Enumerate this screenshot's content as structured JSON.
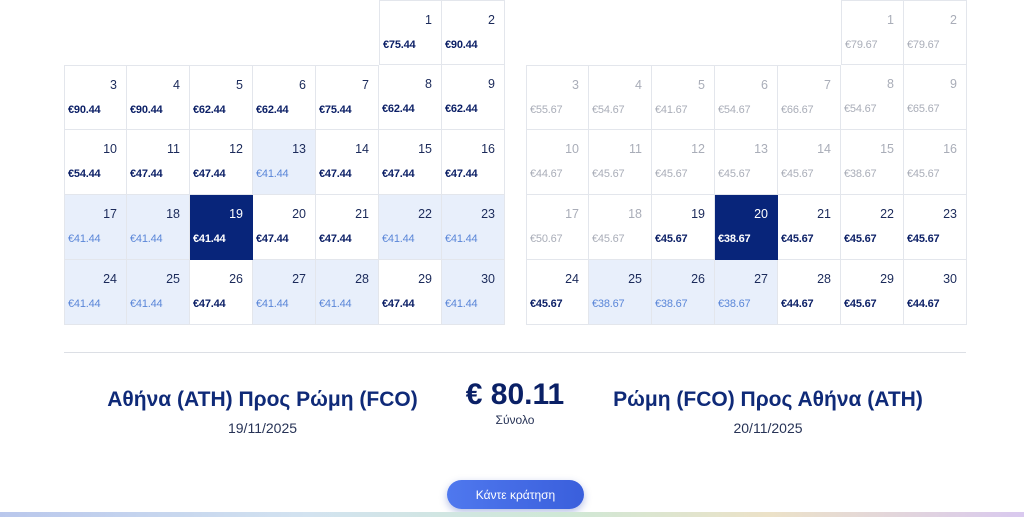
{
  "outbound_calendar": {
    "cells": [
      {
        "day": "1",
        "price": "€75.44",
        "state": "normal"
      },
      {
        "day": "2",
        "price": "€90.44",
        "state": "normal"
      },
      {
        "day": "3",
        "price": "€90.44",
        "state": "normal"
      },
      {
        "day": "4",
        "price": "€90.44",
        "state": "normal"
      },
      {
        "day": "5",
        "price": "€62.44",
        "state": "normal"
      },
      {
        "day": "6",
        "price": "€62.44",
        "state": "normal"
      },
      {
        "day": "7",
        "price": "€75.44",
        "state": "normal"
      },
      {
        "day": "8",
        "price": "€62.44",
        "state": "normal"
      },
      {
        "day": "9",
        "price": "€62.44",
        "state": "normal"
      },
      {
        "day": "10",
        "price": "€54.44",
        "state": "normal"
      },
      {
        "day": "11",
        "price": "€47.44",
        "state": "normal"
      },
      {
        "day": "12",
        "price": "€47.44",
        "state": "normal"
      },
      {
        "day": "13",
        "price": "€41.44",
        "state": "low"
      },
      {
        "day": "14",
        "price": "€47.44",
        "state": "normal"
      },
      {
        "day": "15",
        "price": "€47.44",
        "state": "normal"
      },
      {
        "day": "16",
        "price": "€47.44",
        "state": "normal"
      },
      {
        "day": "17",
        "price": "€41.44",
        "state": "low"
      },
      {
        "day": "18",
        "price": "€41.44",
        "state": "low"
      },
      {
        "day": "19",
        "price": "€41.44",
        "state": "selected"
      },
      {
        "day": "20",
        "price": "€47.44",
        "state": "normal"
      },
      {
        "day": "21",
        "price": "€47.44",
        "state": "normal"
      },
      {
        "day": "22",
        "price": "€41.44",
        "state": "low"
      },
      {
        "day": "23",
        "price": "€41.44",
        "state": "low"
      },
      {
        "day": "24",
        "price": "€41.44",
        "state": "low"
      },
      {
        "day": "25",
        "price": "€41.44",
        "state": "low"
      },
      {
        "day": "26",
        "price": "€47.44",
        "state": "normal"
      },
      {
        "day": "27",
        "price": "€41.44",
        "state": "low"
      },
      {
        "day": "28",
        "price": "€41.44",
        "state": "low"
      },
      {
        "day": "29",
        "price": "€47.44",
        "state": "normal"
      },
      {
        "day": "30",
        "price": "€41.44",
        "state": "low"
      }
    ]
  },
  "return_calendar": {
    "cells": [
      {
        "day": "1",
        "price": "€79.67",
        "state": "disabled"
      },
      {
        "day": "2",
        "price": "€79.67",
        "state": "disabled"
      },
      {
        "day": "3",
        "price": "€55.67",
        "state": "disabled"
      },
      {
        "day": "4",
        "price": "€54.67",
        "state": "disabled"
      },
      {
        "day": "5",
        "price": "€41.67",
        "state": "disabled"
      },
      {
        "day": "6",
        "price": "€54.67",
        "state": "disabled"
      },
      {
        "day": "7",
        "price": "€66.67",
        "state": "disabled"
      },
      {
        "day": "8",
        "price": "€54.67",
        "state": "disabled"
      },
      {
        "day": "9",
        "price": "€65.67",
        "state": "disabled"
      },
      {
        "day": "10",
        "price": "€44.67",
        "state": "disabled"
      },
      {
        "day": "11",
        "price": "€45.67",
        "state": "disabled"
      },
      {
        "day": "12",
        "price": "€45.67",
        "state": "disabled"
      },
      {
        "day": "13",
        "price": "€45.67",
        "state": "disabled"
      },
      {
        "day": "14",
        "price": "€45.67",
        "state": "disabled"
      },
      {
        "day": "15",
        "price": "€38.67",
        "state": "disabled"
      },
      {
        "day": "16",
        "price": "€45.67",
        "state": "disabled"
      },
      {
        "day": "17",
        "price": "€50.67",
        "state": "disabled"
      },
      {
        "day": "18",
        "price": "€45.67",
        "state": "disabled"
      },
      {
        "day": "19",
        "price": "€45.67",
        "state": "normal"
      },
      {
        "day": "20",
        "price": "€38.67",
        "state": "selected"
      },
      {
        "day": "21",
        "price": "€45.67",
        "state": "normal"
      },
      {
        "day": "22",
        "price": "€45.67",
        "state": "normal"
      },
      {
        "day": "23",
        "price": "€45.67",
        "state": "normal"
      },
      {
        "day": "24",
        "price": "€45.67",
        "state": "normal"
      },
      {
        "day": "25",
        "price": "€38.67",
        "state": "low"
      },
      {
        "day": "26",
        "price": "€38.67",
        "state": "low"
      },
      {
        "day": "27",
        "price": "€38.67",
        "state": "low"
      },
      {
        "day": "28",
        "price": "€44.67",
        "state": "normal"
      },
      {
        "day": "29",
        "price": "€45.67",
        "state": "normal"
      },
      {
        "day": "30",
        "price": "€44.67",
        "state": "normal"
      }
    ]
  },
  "summary": {
    "outbound_route": "Αθήνα (ATH) Προς Ρώμη (FCO)",
    "outbound_date": "19/11/2025",
    "total_amount": "€ 80.11",
    "total_label": "Σύνολο",
    "return_route": "Ρώμη (FCO) Προς Αθήνα (ATH)",
    "return_date": "20/11/2025"
  },
  "book_button_label": "Κάντε κράτηση",
  "colors": {
    "selected_bg": "#08257a",
    "low_price_bg": "#e8effb",
    "low_price_text": "#5a86d8",
    "price_text": "#0b1f66",
    "disabled_text": "#a9adb8",
    "button": "#4a6fe8"
  }
}
